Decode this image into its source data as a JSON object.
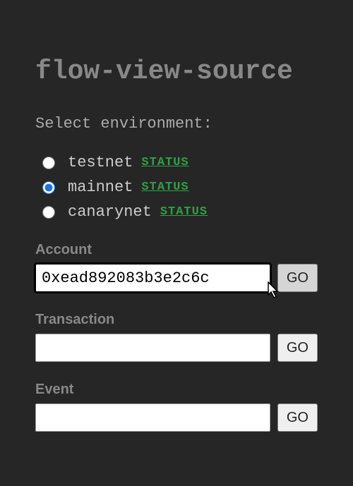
{
  "title": "flow-view-source",
  "subtitle": "Select environment:",
  "environments": [
    {
      "name": "testnet",
      "status_label": "STATUS",
      "checked": false
    },
    {
      "name": "mainnet",
      "status_label": "STATUS",
      "checked": true
    },
    {
      "name": "canarynet",
      "status_label": "STATUS",
      "checked": false
    }
  ],
  "forms": {
    "account": {
      "label": "Account",
      "value": "0xead892083b3e2c6c",
      "button": "GO"
    },
    "transaction": {
      "label": "Transaction",
      "value": "",
      "button": "GO"
    },
    "event": {
      "label": "Event",
      "value": "",
      "button": "GO"
    }
  },
  "colors": {
    "background": "#262626",
    "title": "#888",
    "text": "#aaa",
    "status_link": "#2ea043"
  }
}
